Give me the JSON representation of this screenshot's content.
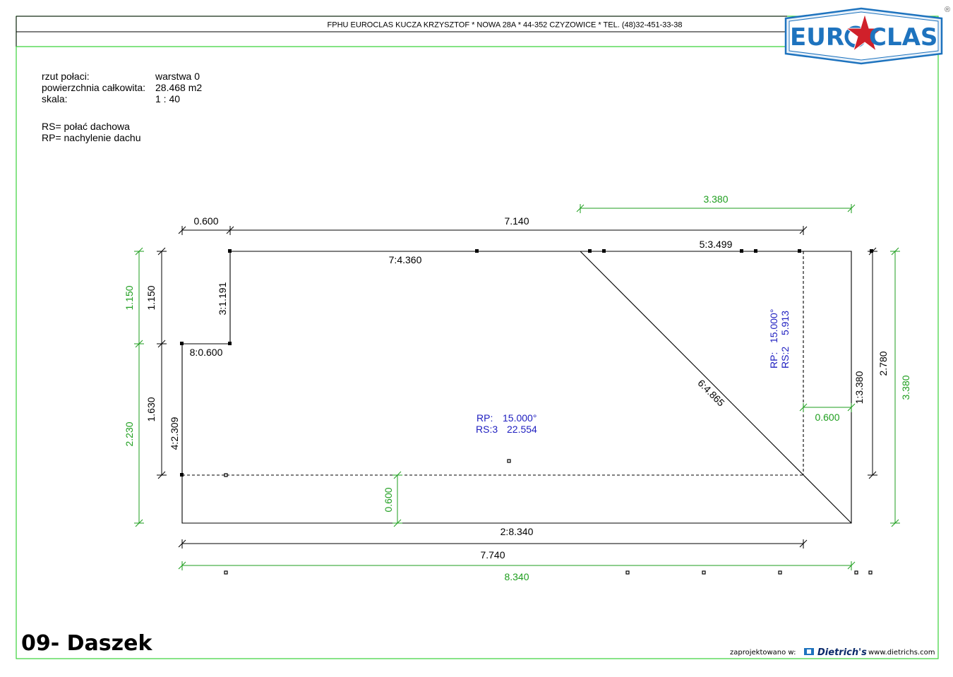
{
  "header": {
    "company": "FPHU EUROCLAS KUCZA KRZYSZTOF * NOWA 28A * 44-352 CZYZOWICE * TEL. (48)32-451-33-38",
    "registered_mark": "®"
  },
  "logo": {
    "text_left": "EUR",
    "text_right": "CLAS",
    "brand_color": "#1e73be",
    "star_color": "#d0202a"
  },
  "info": {
    "rows": [
      {
        "label": "rzut połaci:",
        "value": "warstwa 0"
      },
      {
        "label": "powierzchnia całkowita:",
        "value": "28.468 m2"
      },
      {
        "label": "skala:",
        "value": "1 : 40"
      }
    ],
    "legend": [
      "RS= połać dachowa",
      "RP= nachylenie dachu"
    ]
  },
  "drawing": {
    "dims_black": {
      "top_left": "0.600",
      "top_main": "7.140",
      "left_upper": "1.150",
      "left_lower": "1.630",
      "right_inner": "2.780",
      "bottom": "7.740"
    },
    "dims_green": {
      "top_right": "3.380",
      "left_upper": "1.150",
      "left_lower": "2.230",
      "right": "3.380",
      "inner_right": "0.600",
      "inner_bottom": "0.600",
      "bottom_total": "8.340"
    },
    "segments": {
      "s1": "1:3.380",
      "s2": "2:8.340",
      "s3": "3:1.191",
      "s4": "4:2.309",
      "s5": "5:3.499",
      "s6": "6:4.865",
      "s7": "7:4.360",
      "s8": "8:0.600"
    },
    "areas": [
      {
        "rp_label": "RP:",
        "rp_value": "15.000°",
        "rs_label": "RS:3",
        "rs_value": "22.554"
      },
      {
        "rp_label": "RP:",
        "rp_value": "15.000°",
        "rs_label": "RS:2",
        "rs_value": "5.913"
      }
    ],
    "colors": {
      "dimension_green": "#1e9e1e",
      "roof_label_blue": "#2020c0",
      "outline": "#000000",
      "frame_green": "#3ad33a"
    }
  },
  "footer": {
    "title": "09- Daszek",
    "designed_prefix": "zaprojektowano w:",
    "software": "Dietrich's",
    "website": "www.dietrichs.com"
  }
}
